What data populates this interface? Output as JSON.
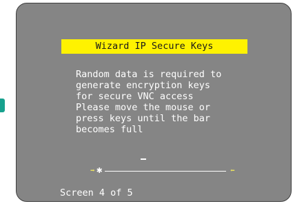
{
  "dialog": {
    "title": "Wizard IP Secure Keys",
    "message_lines": [
      "Random data is required to",
      "generate encryption keys",
      "for secure VNC access",
      "Please move the mouse or",
      "press keys until the bar",
      "becomes full"
    ],
    "cursor_char": "_",
    "progress": {
      "percent": 0,
      "left_arrow_icon": "arrow-right-icon",
      "right_arrow_icon": "arrow-left-icon",
      "left_arrow": "➡",
      "right_arrow": "⬅",
      "marker": "✱"
    },
    "footer": "Screen 4 of 5"
  },
  "colors": {
    "screen_background": "#858585",
    "title_background": "#fff200",
    "text": "#ffffff",
    "side_tab": "#17a18e"
  }
}
